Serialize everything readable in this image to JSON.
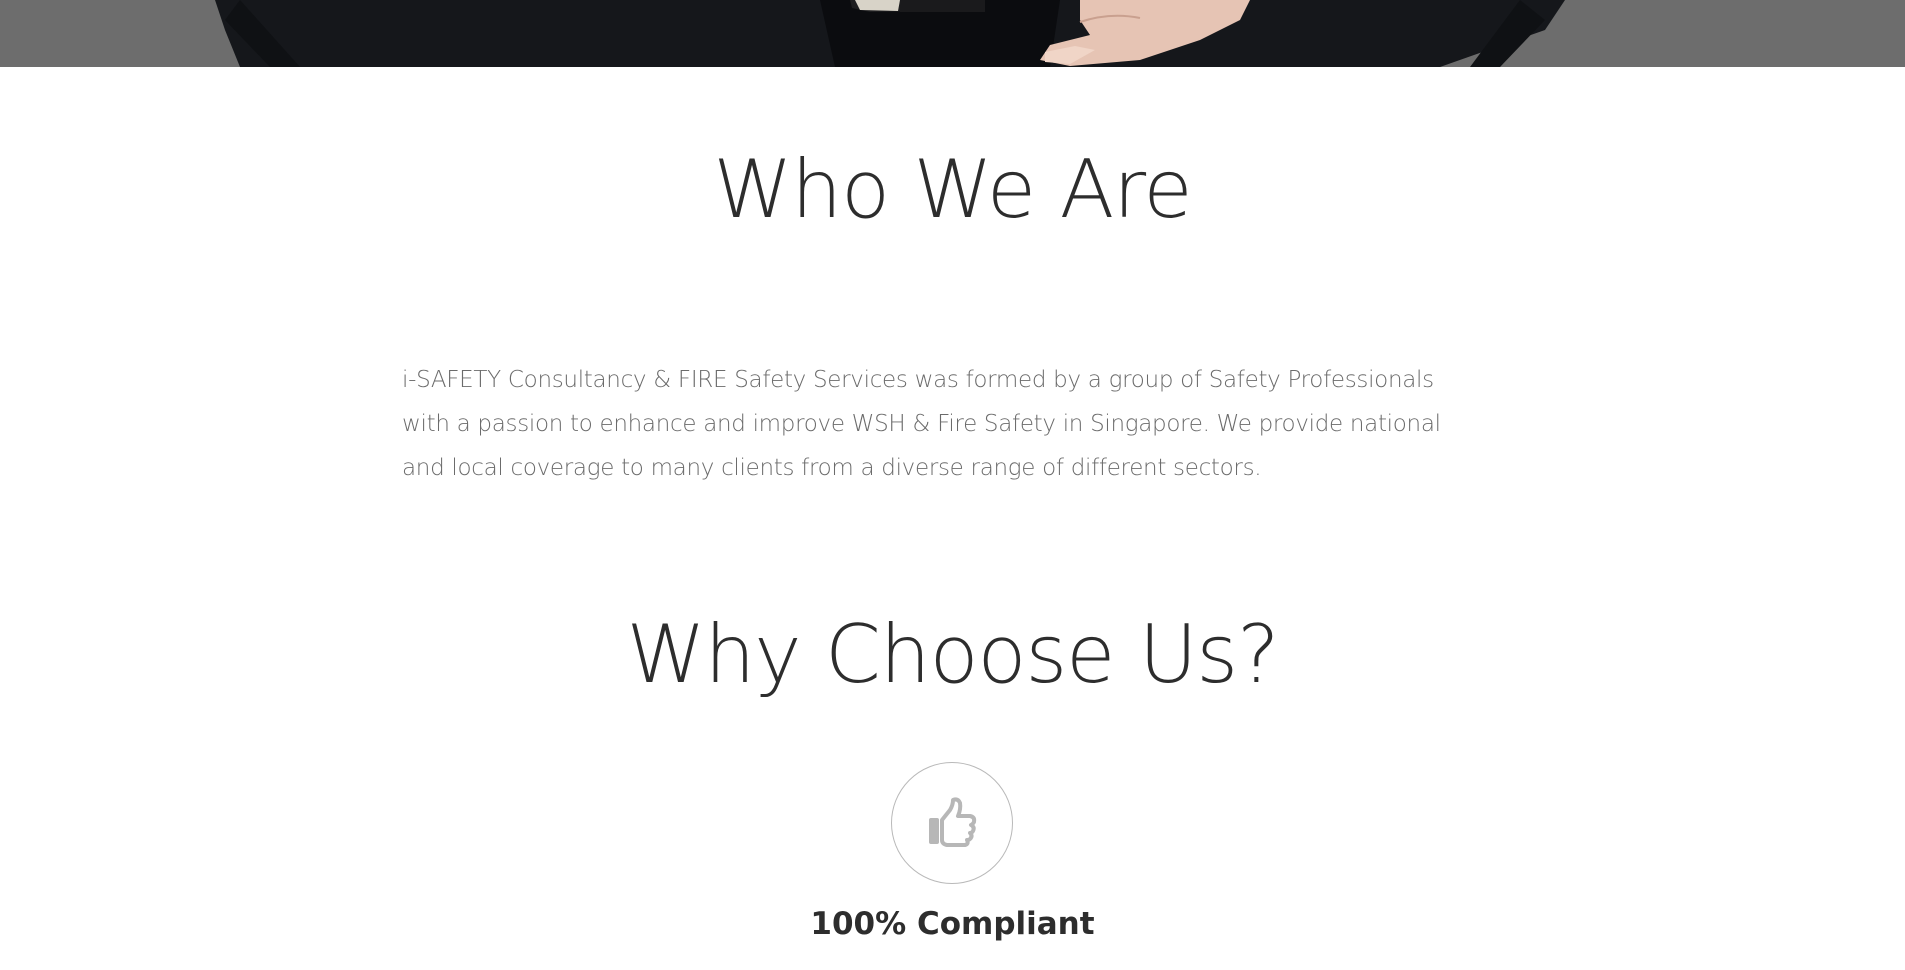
{
  "hero": {
    "image": "man-in-dark-suit-photo",
    "overlay_color": "#6d6d6d"
  },
  "who_we_are": {
    "title": "Who We Are",
    "body": "i-SAFETY Consultancy & FIRE Safety Services was formed by a group of Safety Professionals with a passion to enhance and improve WSH & Fire Safety in Singapore. We provide national and local coverage to many clients from a diverse range of different sectors."
  },
  "why_choose_us": {
    "title": "Why Choose Us?",
    "features": [
      {
        "icon": "thumbs-up-icon",
        "title": "100% Compliant"
      }
    ]
  },
  "colors": {
    "heading": "#2d2d2d",
    "body_text": "#6b6b6b",
    "icon": "#b9b9b9"
  }
}
